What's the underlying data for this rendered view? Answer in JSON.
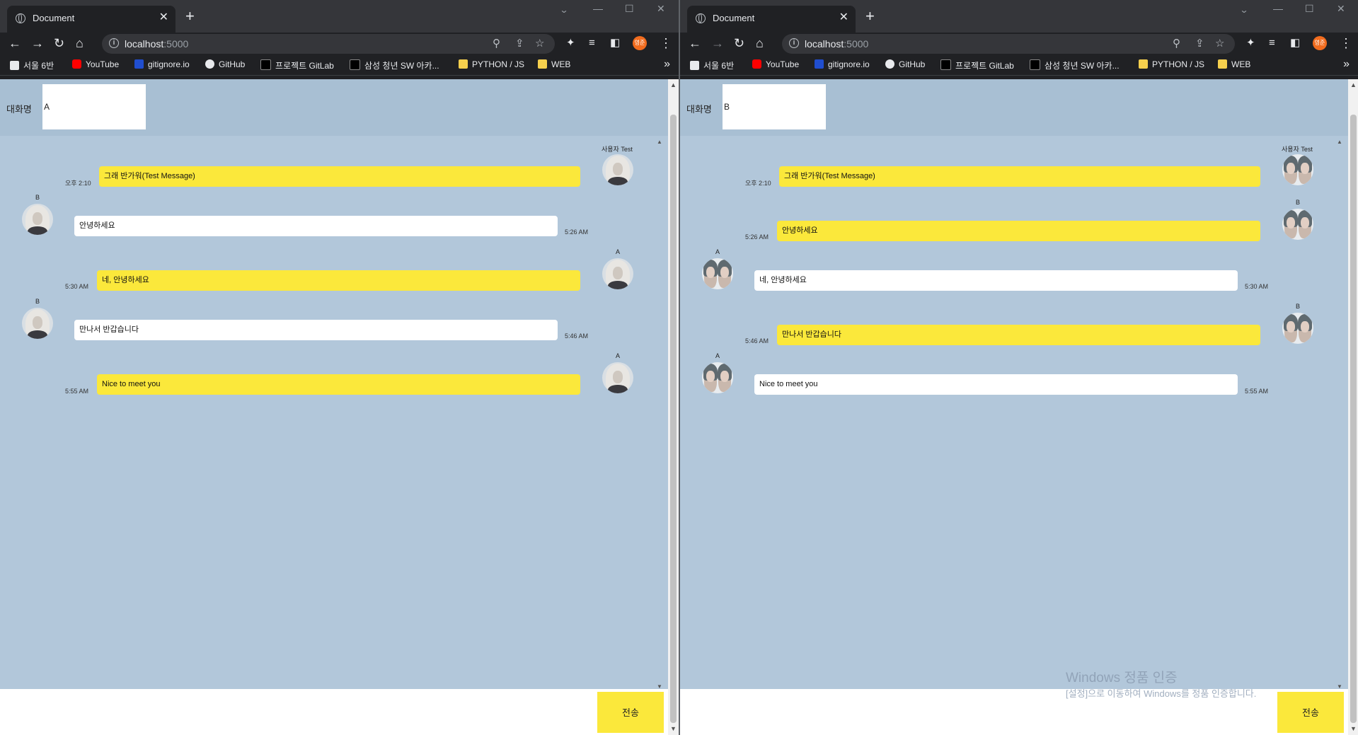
{
  "browser": {
    "tab_title": "Document",
    "url_host": "localhost",
    "url_port": ":5000",
    "profile_label": "영준",
    "bookmarks": [
      "서울 6반",
      "YouTube",
      "gitignore.io",
      "GitHub",
      "프로젝트 GitLab",
      "삼성 청년 SW 아카...",
      "PYTHON / JS",
      "WEB"
    ]
  },
  "colors": {
    "page_bg": "#b2c7da",
    "header_bg": "#a8bfd3",
    "my_bubble": "#fbe83b",
    "other_bubble": "#ffffff",
    "send_button": "#fbe83b"
  },
  "windows": [
    {
      "header_label": "대화명",
      "nickname": "A",
      "send_label": "전송",
      "messages": [
        {
          "side": "mine",
          "sender": "사용자 Test",
          "text": "그래 반가워(Test Message)",
          "time": "오후 2:10"
        },
        {
          "side": "other",
          "sender": "B",
          "text": "안녕하세요",
          "time": "5:26 AM"
        },
        {
          "side": "mine",
          "sender": "A",
          "text": "네, 안녕하세요",
          "time": "5:30 AM"
        },
        {
          "side": "other",
          "sender": "B",
          "text": "만나서 반갑습니다",
          "time": "5:46 AM"
        },
        {
          "side": "mine",
          "sender": "A",
          "text": "Nice to meet you",
          "time": "5:55 AM"
        }
      ]
    },
    {
      "header_label": "대화명",
      "nickname": "B",
      "send_label": "전송",
      "messages": [
        {
          "side": "mine",
          "sender": "사용자 Test",
          "text": "그래 반가워(Test Message)",
          "time": "오후 2:10"
        },
        {
          "side": "mine",
          "sender": "B",
          "text": "안녕하세요",
          "time": "5:26 AM"
        },
        {
          "side": "other",
          "sender": "A",
          "text": "네, 안녕하세요",
          "time": "5:30 AM"
        },
        {
          "side": "mine",
          "sender": "B",
          "text": "만나서 반갑습니다",
          "time": "5:46 AM"
        },
        {
          "side": "other",
          "sender": "A",
          "text": "Nice to meet you",
          "time": "5:55 AM"
        }
      ]
    }
  ],
  "watermark": {
    "line1": "Windows 정품 인증",
    "line2": "[설정]으로 이동하여 Windows를 정품 인증합니다."
  }
}
